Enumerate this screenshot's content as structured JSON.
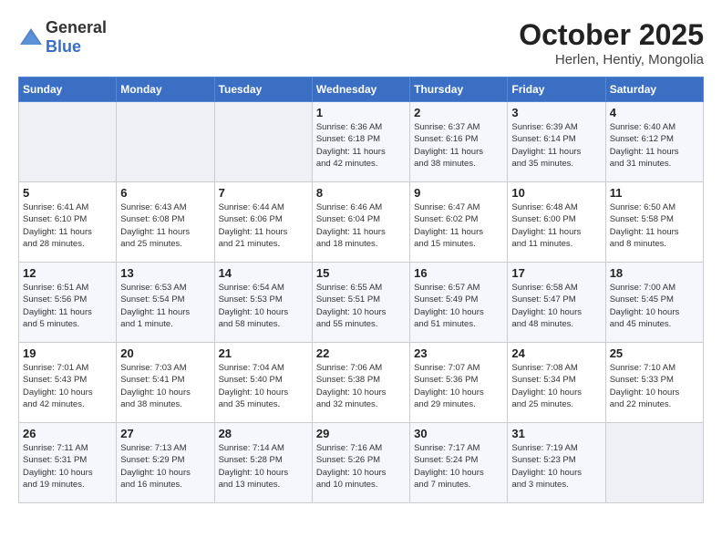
{
  "header": {
    "logo_general": "General",
    "logo_blue": "Blue",
    "title": "October 2025",
    "subtitle": "Herlen, Hentiy, Mongolia"
  },
  "days_of_week": [
    "Sunday",
    "Monday",
    "Tuesday",
    "Wednesday",
    "Thursday",
    "Friday",
    "Saturday"
  ],
  "weeks": [
    [
      {
        "day": "",
        "info": ""
      },
      {
        "day": "",
        "info": ""
      },
      {
        "day": "",
        "info": ""
      },
      {
        "day": "1",
        "info": "Sunrise: 6:36 AM\nSunset: 6:18 PM\nDaylight: 11 hours\nand 42 minutes."
      },
      {
        "day": "2",
        "info": "Sunrise: 6:37 AM\nSunset: 6:16 PM\nDaylight: 11 hours\nand 38 minutes."
      },
      {
        "day": "3",
        "info": "Sunrise: 6:39 AM\nSunset: 6:14 PM\nDaylight: 11 hours\nand 35 minutes."
      },
      {
        "day": "4",
        "info": "Sunrise: 6:40 AM\nSunset: 6:12 PM\nDaylight: 11 hours\nand 31 minutes."
      }
    ],
    [
      {
        "day": "5",
        "info": "Sunrise: 6:41 AM\nSunset: 6:10 PM\nDaylight: 11 hours\nand 28 minutes."
      },
      {
        "day": "6",
        "info": "Sunrise: 6:43 AM\nSunset: 6:08 PM\nDaylight: 11 hours\nand 25 minutes."
      },
      {
        "day": "7",
        "info": "Sunrise: 6:44 AM\nSunset: 6:06 PM\nDaylight: 11 hours\nand 21 minutes."
      },
      {
        "day": "8",
        "info": "Sunrise: 6:46 AM\nSunset: 6:04 PM\nDaylight: 11 hours\nand 18 minutes."
      },
      {
        "day": "9",
        "info": "Sunrise: 6:47 AM\nSunset: 6:02 PM\nDaylight: 11 hours\nand 15 minutes."
      },
      {
        "day": "10",
        "info": "Sunrise: 6:48 AM\nSunset: 6:00 PM\nDaylight: 11 hours\nand 11 minutes."
      },
      {
        "day": "11",
        "info": "Sunrise: 6:50 AM\nSunset: 5:58 PM\nDaylight: 11 hours\nand 8 minutes."
      }
    ],
    [
      {
        "day": "12",
        "info": "Sunrise: 6:51 AM\nSunset: 5:56 PM\nDaylight: 11 hours\nand 5 minutes."
      },
      {
        "day": "13",
        "info": "Sunrise: 6:53 AM\nSunset: 5:54 PM\nDaylight: 11 hours\nand 1 minute."
      },
      {
        "day": "14",
        "info": "Sunrise: 6:54 AM\nSunset: 5:53 PM\nDaylight: 10 hours\nand 58 minutes."
      },
      {
        "day": "15",
        "info": "Sunrise: 6:55 AM\nSunset: 5:51 PM\nDaylight: 10 hours\nand 55 minutes."
      },
      {
        "day": "16",
        "info": "Sunrise: 6:57 AM\nSunset: 5:49 PM\nDaylight: 10 hours\nand 51 minutes."
      },
      {
        "day": "17",
        "info": "Sunrise: 6:58 AM\nSunset: 5:47 PM\nDaylight: 10 hours\nand 48 minutes."
      },
      {
        "day": "18",
        "info": "Sunrise: 7:00 AM\nSunset: 5:45 PM\nDaylight: 10 hours\nand 45 minutes."
      }
    ],
    [
      {
        "day": "19",
        "info": "Sunrise: 7:01 AM\nSunset: 5:43 PM\nDaylight: 10 hours\nand 42 minutes."
      },
      {
        "day": "20",
        "info": "Sunrise: 7:03 AM\nSunset: 5:41 PM\nDaylight: 10 hours\nand 38 minutes."
      },
      {
        "day": "21",
        "info": "Sunrise: 7:04 AM\nSunset: 5:40 PM\nDaylight: 10 hours\nand 35 minutes."
      },
      {
        "day": "22",
        "info": "Sunrise: 7:06 AM\nSunset: 5:38 PM\nDaylight: 10 hours\nand 32 minutes."
      },
      {
        "day": "23",
        "info": "Sunrise: 7:07 AM\nSunset: 5:36 PM\nDaylight: 10 hours\nand 29 minutes."
      },
      {
        "day": "24",
        "info": "Sunrise: 7:08 AM\nSunset: 5:34 PM\nDaylight: 10 hours\nand 25 minutes."
      },
      {
        "day": "25",
        "info": "Sunrise: 7:10 AM\nSunset: 5:33 PM\nDaylight: 10 hours\nand 22 minutes."
      }
    ],
    [
      {
        "day": "26",
        "info": "Sunrise: 7:11 AM\nSunset: 5:31 PM\nDaylight: 10 hours\nand 19 minutes."
      },
      {
        "day": "27",
        "info": "Sunrise: 7:13 AM\nSunset: 5:29 PM\nDaylight: 10 hours\nand 16 minutes."
      },
      {
        "day": "28",
        "info": "Sunrise: 7:14 AM\nSunset: 5:28 PM\nDaylight: 10 hours\nand 13 minutes."
      },
      {
        "day": "29",
        "info": "Sunrise: 7:16 AM\nSunset: 5:26 PM\nDaylight: 10 hours\nand 10 minutes."
      },
      {
        "day": "30",
        "info": "Sunrise: 7:17 AM\nSunset: 5:24 PM\nDaylight: 10 hours\nand 7 minutes."
      },
      {
        "day": "31",
        "info": "Sunrise: 7:19 AM\nSunset: 5:23 PM\nDaylight: 10 hours\nand 3 minutes."
      },
      {
        "day": "",
        "info": ""
      }
    ]
  ]
}
